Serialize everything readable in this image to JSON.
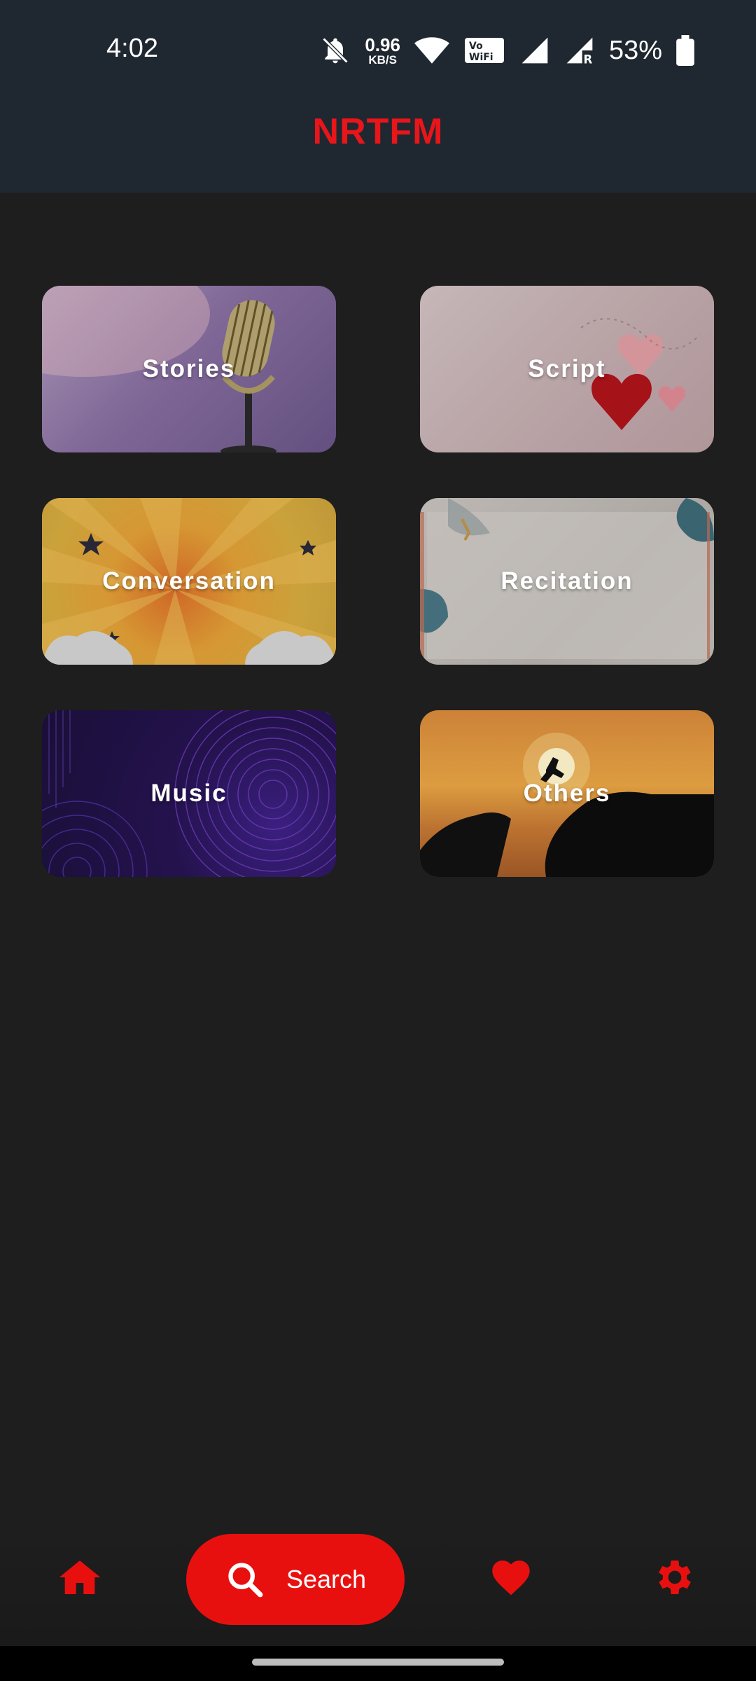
{
  "status_bar": {
    "time": "4:02",
    "speed_value": "0.96",
    "speed_unit": "KB/S",
    "battery": "53%"
  },
  "app": {
    "title": "NRTFM"
  },
  "categories": [
    {
      "label": "Stories"
    },
    {
      "label": "Script"
    },
    {
      "label": "Conversation"
    },
    {
      "label": "Recitation"
    },
    {
      "label": "Music"
    },
    {
      "label": "Others"
    }
  ],
  "bottom_nav": {
    "search_label": "Search",
    "icons": [
      "home-icon",
      "search-icon",
      "heart-icon",
      "gear-icon"
    ],
    "accent_color": "#e8100f"
  }
}
